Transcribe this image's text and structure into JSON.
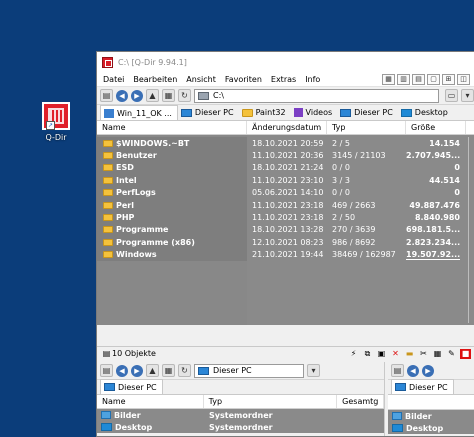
{
  "desktop": {
    "icon_label": "Q-Dir"
  },
  "window": {
    "title": "C:\\  [Q-Dir 9.94.1]",
    "menu": [
      "Datei",
      "Bearbeiten",
      "Ansicht",
      "Favoriten",
      "Extras",
      "Info"
    ],
    "address": "C:\\",
    "tabs": [
      {
        "label": "Win_11_OK ...",
        "icon": "home-icon"
      },
      {
        "label": "Dieser PC",
        "icon": "pc-icon"
      },
      {
        "label": "Paint32",
        "icon": "folder-icon"
      },
      {
        "label": "Videos",
        "icon": "video-icon"
      },
      {
        "label": "Dieser PC",
        "icon": "pc-icon"
      },
      {
        "label": "Desktop",
        "icon": "desktop-icon"
      }
    ],
    "columns": [
      "Name",
      "Änderungsdatum",
      "Typ",
      "Größe"
    ],
    "rows": [
      {
        "name": "$WINDOWS.~BT",
        "date": "18.10.2021 20:59",
        "type": "2 / 5",
        "size": "14.154"
      },
      {
        "name": "Benutzer",
        "date": "11.10.2021 20:36",
        "type": "3145 / 21103",
        "size": "2.707.945..."
      },
      {
        "name": "ESD",
        "date": "18.10.2021 21:24",
        "type": "0 / 0",
        "size": "0"
      },
      {
        "name": "Intel",
        "date": "11.10.2021 23:10",
        "type": "3 / 3",
        "size": "44.514"
      },
      {
        "name": "PerfLogs",
        "date": "05.06.2021 14:10",
        "type": "0 / 0",
        "size": "0"
      },
      {
        "name": "Perl",
        "date": "11.10.2021 23:18",
        "type": "469 / 2663",
        "size": "49.887.476"
      },
      {
        "name": "PHP",
        "date": "11.10.2021 23:18",
        "type": "2 / 50",
        "size": "8.840.980"
      },
      {
        "name": "Programme",
        "date": "18.10.2021 13:28",
        "type": "270 / 3639",
        "size": "698.181.5..."
      },
      {
        "name": "Programme (x86)",
        "date": "12.10.2021 08:23",
        "type": "986 / 8692",
        "size": "2.823.234..."
      },
      {
        "name": "Windows",
        "date": "21.10.2021 19:44",
        "type": "38469 / 162987",
        "size": "19.507.92..."
      }
    ],
    "status": "10 Objekte",
    "lower_left": {
      "address": "Dieser PC",
      "tab": "Dieser PC",
      "columns": [
        "Name",
        "Typ",
        "Gesamtg"
      ],
      "rows": [
        {
          "name": "Bilder",
          "type": "Systemordner"
        },
        {
          "name": "Desktop",
          "type": "Systemordner"
        }
      ]
    },
    "lower_right": {
      "tab": "Dieser PC",
      "rows": [
        "Bilder",
        "Desktop"
      ]
    }
  }
}
